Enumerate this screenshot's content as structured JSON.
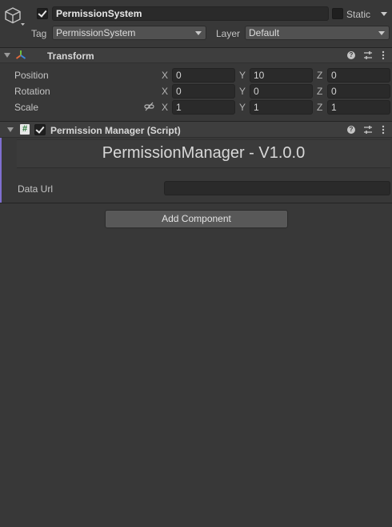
{
  "header": {
    "object_active": true,
    "object_name": "PermissionSystem",
    "static_label": "Static",
    "tag_label": "Tag",
    "tag_value": "PermissionSystem",
    "layer_label": "Layer",
    "layer_value": "Default"
  },
  "transform": {
    "title": "Transform",
    "position_label": "Position",
    "rotation_label": "Rotation",
    "scale_label": "Scale",
    "axis_x": "X",
    "axis_y": "Y",
    "axis_z": "Z",
    "position": {
      "x": "0",
      "y": "10",
      "z": "0"
    },
    "rotation": {
      "x": "0",
      "y": "0",
      "z": "0"
    },
    "scale": {
      "x": "1",
      "y": "1",
      "z": "1"
    }
  },
  "script_component": {
    "enabled": true,
    "title": "Permission Manager (Script)",
    "banner": "PermissionManager - V1.0.0",
    "data_url_label": "Data Url",
    "data_url_value": ""
  },
  "add_component_label": "Add Component",
  "colors": {
    "background": "#383838",
    "field": "#2a2a2a",
    "accent": "#7f6fd0"
  },
  "icons": [
    "gameobject-cube-icon",
    "transform-axes-icon",
    "script-hash-icon",
    "help-icon",
    "preset-sliders-icon",
    "kebab-menu-icon",
    "constrain-proportions-icon"
  ]
}
